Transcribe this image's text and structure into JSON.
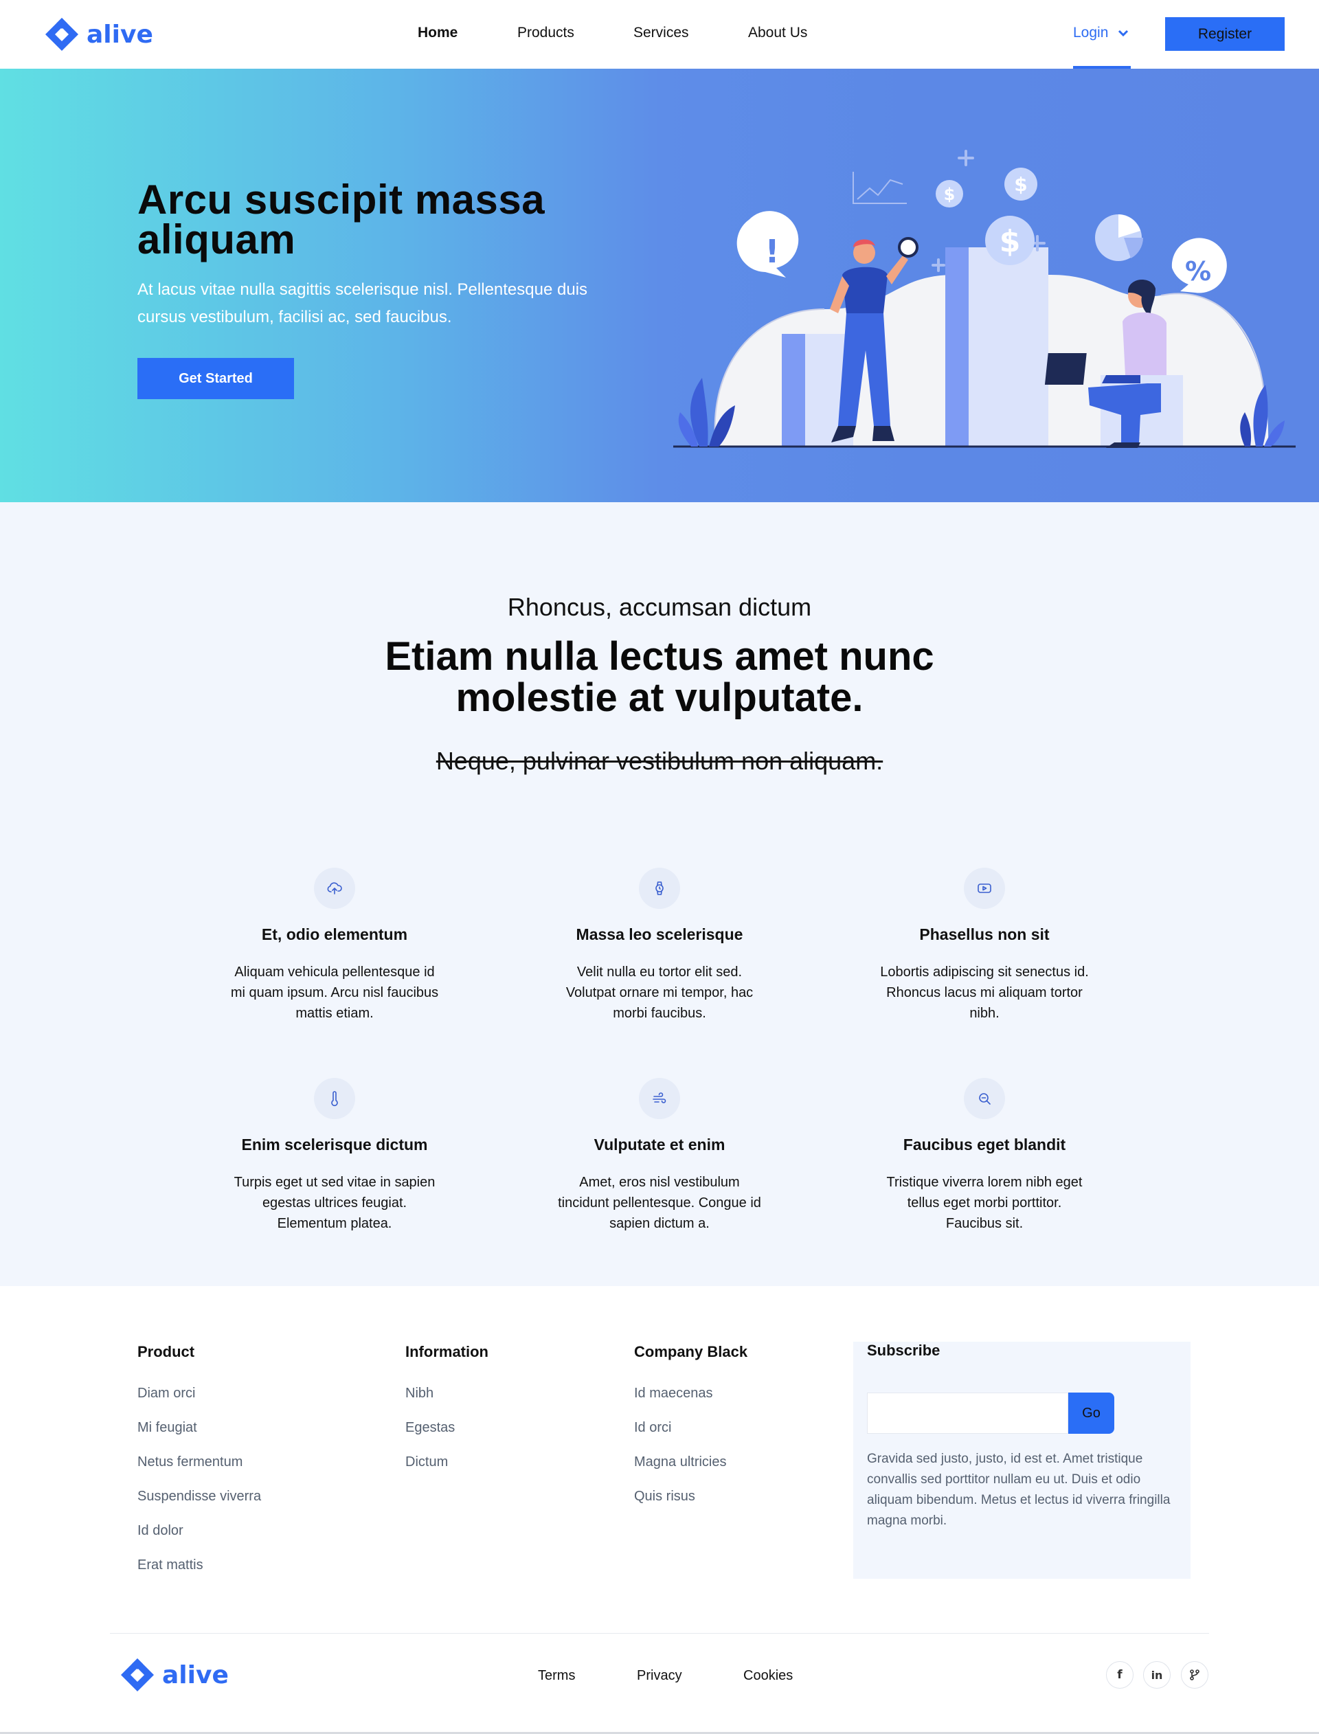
{
  "nav": {
    "brand": "alive",
    "links": [
      "Home",
      "Products",
      "Services",
      "About Us"
    ],
    "active": "Home",
    "login_label": "Login",
    "register_label": "Register"
  },
  "hero": {
    "title": "Arcu suscipit massa aliquam",
    "subtitle": "At lacus vitae nulla sagittis scelerisque nisl. Pellentesque duis cursus vestibulum, facilisi ac, sed faucibus.",
    "cta_label": "Get Started",
    "illustration_glyphs": [
      "!",
      "$",
      "$",
      "$",
      "%"
    ]
  },
  "features": {
    "eyebrow": "Rhoncus, accumsan dictum",
    "title": "Etiam nulla lectus amet nunc molestie at vulputate.",
    "strikethrough": "Neque, pulvinar vestibulum non aliquam.",
    "cards": [
      {
        "icon": "upload-cloud-icon",
        "title": "Et, odio elementum",
        "text": "Aliquam vehicula pellentesque id mi quam ipsum. Arcu nisl faucibus mattis etiam."
      },
      {
        "icon": "watch-icon",
        "title": "Massa leo scelerisque",
        "text": "Velit nulla eu tortor elit sed. Volutpat ornare mi tempor, hac morbi faucibus."
      },
      {
        "icon": "video-icon",
        "title": "Phasellus non sit",
        "text": "Lobortis adipiscing sit senectus id. Rhoncus lacus mi aliquam tortor nibh."
      },
      {
        "icon": "thermometer-icon",
        "title": "Enim scelerisque dictum",
        "text": "Turpis eget ut sed vitae in sapien egestas ultrices feugiat. Elementum platea."
      },
      {
        "icon": "wind-icon",
        "title": "Vulputate et enim",
        "text": "Amet, eros nisl vestibulum tincidunt pellentesque. Congue id sapien dictum a."
      },
      {
        "icon": "zoom-out-icon",
        "title": "Faucibus eget blandit",
        "text": "Tristique viverra lorem nibh eget tellus eget morbi porttitor. Faucibus sit."
      }
    ]
  },
  "footer": {
    "columns": [
      {
        "heading": "Product",
        "links": [
          "Diam orci",
          "Mi feugiat",
          "Netus fermentum",
          "Suspendisse viverra",
          "Id dolor",
          "Erat mattis"
        ]
      },
      {
        "heading": "Information",
        "links": [
          "Nibh",
          "Egestas",
          "Dictum"
        ]
      },
      {
        "heading": "Company Black",
        "links": [
          "Id maecenas",
          "Id orci",
          "Magna ultricies",
          "Quis risus"
        ]
      }
    ],
    "subscribe": {
      "heading": "Subscribe",
      "input_value": "",
      "button_label": "Go",
      "text": "Gravida sed justo, justo, id est et. Amet tristique convallis sed porttitor nullam eu ut. Duis et odio aliquam bibendum. Metus et lectus id viverra fringilla magna morbi."
    },
    "brand": "alive",
    "legal_links": [
      "Terms",
      "Privacy",
      "Cookies"
    ],
    "social": [
      {
        "icon": "facebook-icon",
        "label": "f"
      },
      {
        "icon": "linkedin-icon",
        "label": "in"
      },
      {
        "icon": "fork-icon",
        "label": ""
      }
    ]
  },
  "colors": {
    "brand_blue": "#2a6ef6",
    "link_blue": "#2e6cf2",
    "hero_start": "#60dfe3",
    "hero_end": "#5c86e5",
    "section_bg": "#f2f6fd"
  }
}
